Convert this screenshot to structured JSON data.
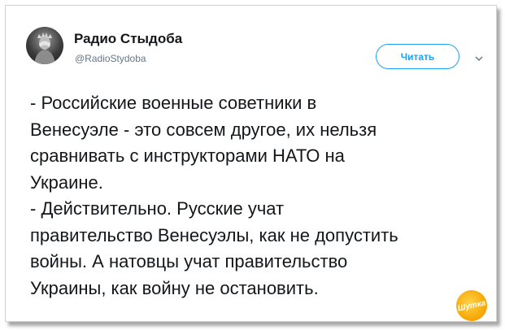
{
  "profile": {
    "display_name": "Радио Стыдоба",
    "handle": "@RadioStydoba",
    "avatar_icon": "statue-of-liberty-facepalm-avatar"
  },
  "follow_button": {
    "label": "Читать"
  },
  "menu": {
    "icon": "chevron-down-icon"
  },
  "tweet": {
    "lines": [
      "- Российские военные советники в",
      "Венесуэле - это совсем другое, их нельзя",
      "сравнивать с инструкторами НАТО на",
      "Украине.",
      "- Действительно. Русские учат",
      "правительство Венесуэлы, как не допустить",
      "войны. А натовцы учат правительство",
      "Украины, как войну не остановить."
    ]
  },
  "watermark": {
    "text": "Шутка",
    "color": "#f6a400"
  },
  "colors": {
    "accent": "#1da1f2",
    "text": "#14171a",
    "muted": "#657786"
  }
}
